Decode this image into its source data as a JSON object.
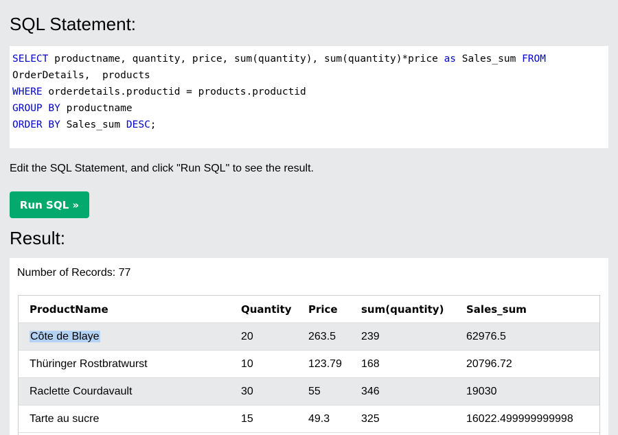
{
  "sql_section": {
    "heading": "SQL Statement:",
    "code_lines": [
      [
        {
          "t": "SELECT",
          "k": true
        },
        {
          "t": " productname, quantity, price, sum(quantity), sum(quantity)*price ",
          "k": false
        },
        {
          "t": "as",
          "k": true
        },
        {
          "t": " Sales_sum ",
          "k": false
        },
        {
          "t": "FROM",
          "k": true
        }
      ],
      [
        {
          "t": "OrderDetails,  products",
          "k": false
        }
      ],
      [
        {
          "t": "WHERE",
          "k": true
        },
        {
          "t": " orderdetails.productid = products.productid",
          "k": false
        }
      ],
      [
        {
          "t": "GROUP BY",
          "k": true
        },
        {
          "t": " productname",
          "k": false
        }
      ],
      [
        {
          "t": "ORDER BY",
          "k": true
        },
        {
          "t": " Sales_sum ",
          "k": false
        },
        {
          "t": "DESC",
          "k": true
        },
        {
          "t": ";",
          "k": false
        }
      ]
    ],
    "keyword_color": "#0000cd"
  },
  "hint_text": "Edit the SQL Statement, and click \"Run SQL\" to see the result.",
  "run_button_label": "Run SQL »",
  "run_button_color": "#04aa6d",
  "result_section": {
    "heading": "Result:",
    "records_text": "Number of Records: 77",
    "columns": [
      "ProductName",
      "Quantity",
      "Price",
      "sum(quantity)",
      "Sales_sum"
    ],
    "rows": [
      [
        "Côte de Blaye",
        "20",
        "263.5",
        "239",
        "62976.5"
      ],
      [
        "Thüringer Rostbratwurst",
        "10",
        "123.79",
        "168",
        "20796.72"
      ],
      [
        "Raclette Courdavault",
        "30",
        "55",
        "346",
        "19030"
      ],
      [
        "Tarte au sucre",
        "15",
        "49.3",
        "325",
        "16022.499999999998"
      ]
    ],
    "selected_text_cell": {
      "row": 0,
      "col": 0
    }
  }
}
